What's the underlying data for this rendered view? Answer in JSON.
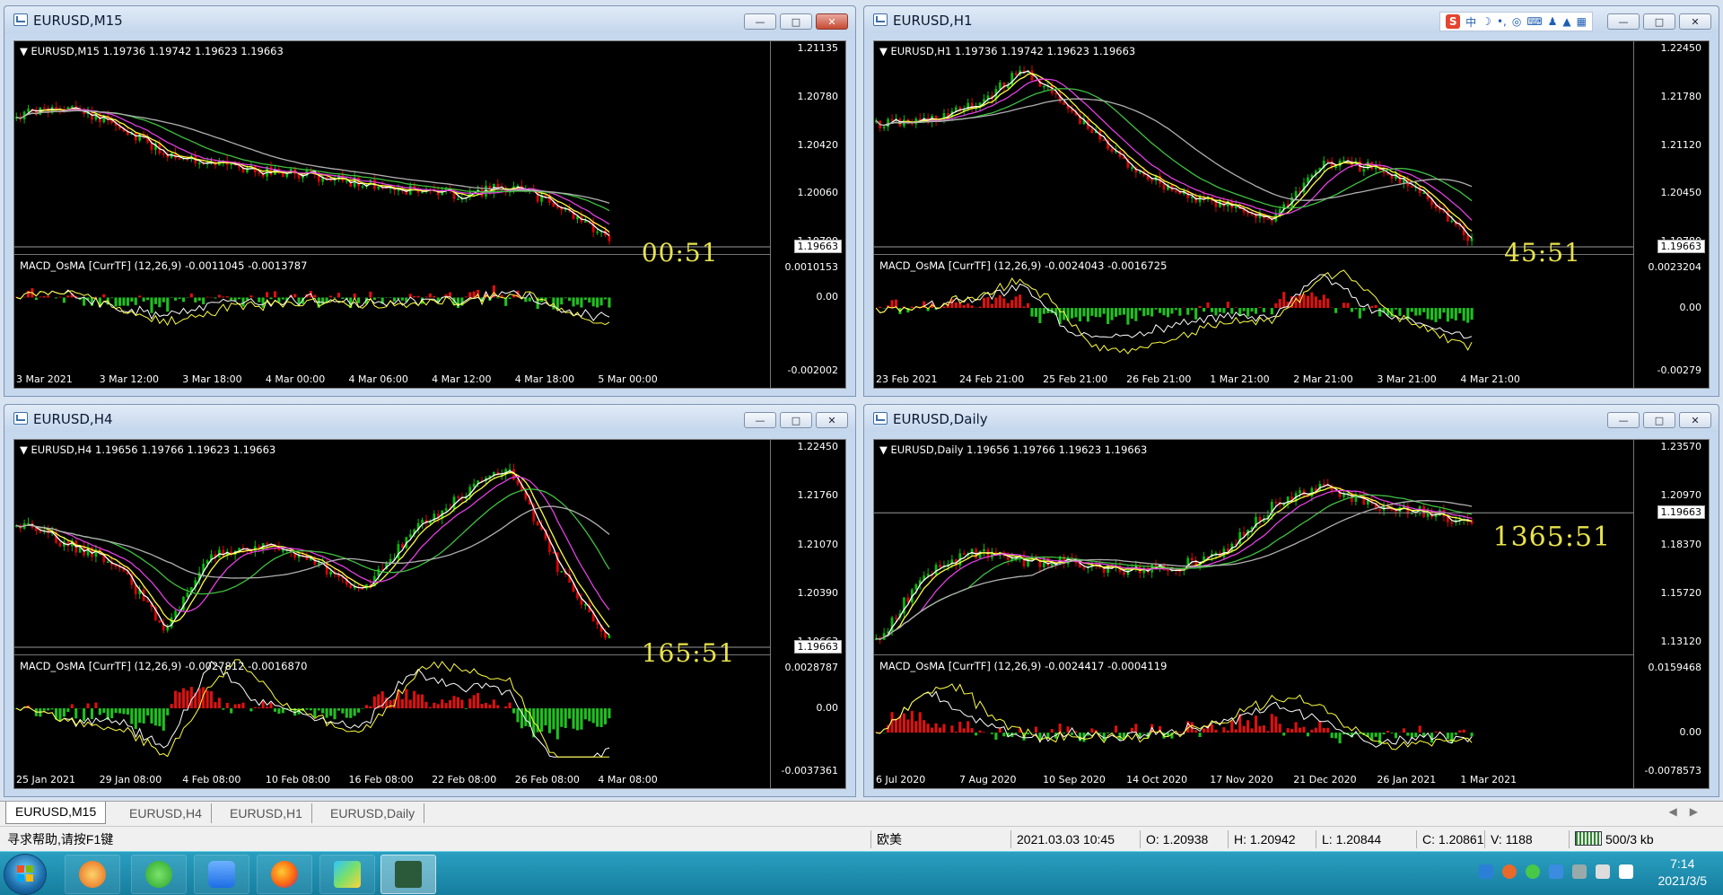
{
  "colors": {
    "bull": "#00c000",
    "bear": "#e00000",
    "ma_white": "#ffffff",
    "ma_yellow": "#ffff40",
    "ma_magenta": "#e040e0",
    "ma_green": "#40c040",
    "ma_gray": "#b0b0b0",
    "hist_pos": "#e01010",
    "hist_neg": "#20c020",
    "timer": "#e8e34a"
  },
  "windows": [
    {
      "title": "EURUSD,M15",
      "ohlc": "EURUSD,M15  1.19736 1.19742 1.19623 1.19663",
      "price_labels": [
        "1.21135",
        "1.20780",
        "1.20420",
        "1.20060",
        "1.19700"
      ],
      "current_price": "1.19663",
      "timer": "00:51",
      "macd": "MACD_OsMA [CurrTF] (12,26,9) -0.0011045 -0.0013787",
      "macd_labels": [
        "0.0010153",
        "0.00",
        "-0.002002"
      ],
      "time_labels": [
        "3 Mar 2021",
        "3 Mar 12:00",
        "3 Mar 18:00",
        "4 Mar 00:00",
        "4 Mar 06:00",
        "4 Mar 12:00",
        "4 Mar 18:00",
        "5 Mar 00:00"
      ],
      "close_style": "red",
      "trend": [
        0.3,
        0.25,
        0.35,
        0.5,
        0.55,
        0.6,
        0.62,
        0.66,
        0.7,
        0.72,
        0.68,
        0.78,
        0.96
      ]
    },
    {
      "title": "EURUSD,H1",
      "ohlc": "EURUSD,H1  1.19736 1.19742 1.19623 1.19663",
      "price_labels": [
        "1.22450",
        "1.21780",
        "1.21120",
        "1.20450",
        "1.19780"
      ],
      "current_price": "1.19663",
      "timer": "45:51",
      "macd": "MACD_OsMA [CurrTF] (12,26,9) -0.0024043 -0.0016725",
      "macd_labels": [
        "0.0023204",
        "0.00",
        "-0.00279"
      ],
      "time_labels": [
        "23 Feb 2021",
        "24 Feb 21:00",
        "25 Feb 21:00",
        "26 Feb 21:00",
        "1 Mar 21:00",
        "2 Mar 21:00",
        "3 Mar 21:00",
        "4 Mar 21:00"
      ],
      "close_style": "plain",
      "trend": [
        0.35,
        0.33,
        0.25,
        0.05,
        0.3,
        0.55,
        0.7,
        0.78,
        0.85,
        0.55,
        0.58,
        0.7,
        0.98
      ]
    },
    {
      "title": "EURUSD,H4",
      "ohlc": "EURUSD,H4  1.19656 1.19766 1.19623 1.19663",
      "price_labels": [
        "1.22450",
        "1.21760",
        "1.21070",
        "1.20390",
        "1.19663"
      ],
      "current_price": "1.19663",
      "timer": "165:51",
      "macd": "MACD_OsMA [CurrTF] (12,26,9) -0.0027812 -0.0016870",
      "macd_labels": [
        "0.0028787",
        "0.00",
        "-0.0037361"
      ],
      "time_labels": [
        "25 Jan 2021",
        "29 Jan 08:00",
        "4 Feb 08:00",
        "10 Feb 08:00",
        "16 Feb 08:00",
        "22 Feb 08:00",
        "26 Feb 08:00",
        "4 Mar 08:00"
      ],
      "close_style": "plain",
      "trend": [
        0.35,
        0.45,
        0.55,
        0.9,
        0.5,
        0.45,
        0.55,
        0.7,
        0.4,
        0.2,
        0.05,
        0.6,
        0.95
      ]
    },
    {
      "title": "EURUSD,Daily",
      "ohlc": "EURUSD,Daily  1.19656 1.19766 1.19623 1.19663",
      "price_labels": [
        "1.23570",
        "1.20970",
        "1.18370",
        "1.15720",
        "1.13120"
      ],
      "current_price": "1.19663",
      "timer": "1365:51",
      "macd": "MACD_OsMA [CurrTF] (12,26,9) -0.0024417 -0.0004119",
      "macd_labels": [
        "0.0159468",
        "0.00",
        "-0.0078573"
      ],
      "time_labels": [
        "6 Jul 2020",
        "7 Aug 2020",
        "10 Sep 2020",
        "14 Oct 2020",
        "17 Nov 2020",
        "21 Dec 2020",
        "26 Jan 2021",
        "1 Mar 2021"
      ],
      "close_style": "plain",
      "trend": [
        0.98,
        0.6,
        0.5,
        0.55,
        0.55,
        0.6,
        0.58,
        0.5,
        0.25,
        0.15,
        0.25,
        0.28,
        0.35
      ]
    }
  ],
  "ime_toolbar": {
    "logo": "S",
    "label": "中"
  },
  "tabs": [
    "EURUSD,M15",
    "EURUSD,H4",
    "EURUSD,H1",
    "EURUSD,Daily"
  ],
  "active_tab": 0,
  "status": {
    "help": "寻求帮助,请按F1键",
    "profile": "欧美",
    "datetime": "2021.03.03 10:45",
    "open": "O: 1.20938",
    "high": "H: 1.20942",
    "low": "L: 1.20844",
    "close": "C: 1.20861",
    "volume": "V: 1188",
    "traffic": "500/3 kb"
  },
  "taskbar": {
    "apps": [
      "browser-icon",
      "wechat-icon",
      "notes-icon",
      "firefox-icon",
      "video-player-icon",
      "mt4-icon"
    ],
    "clock_time": "7:14",
    "clock_date": "2021/3/5"
  }
}
